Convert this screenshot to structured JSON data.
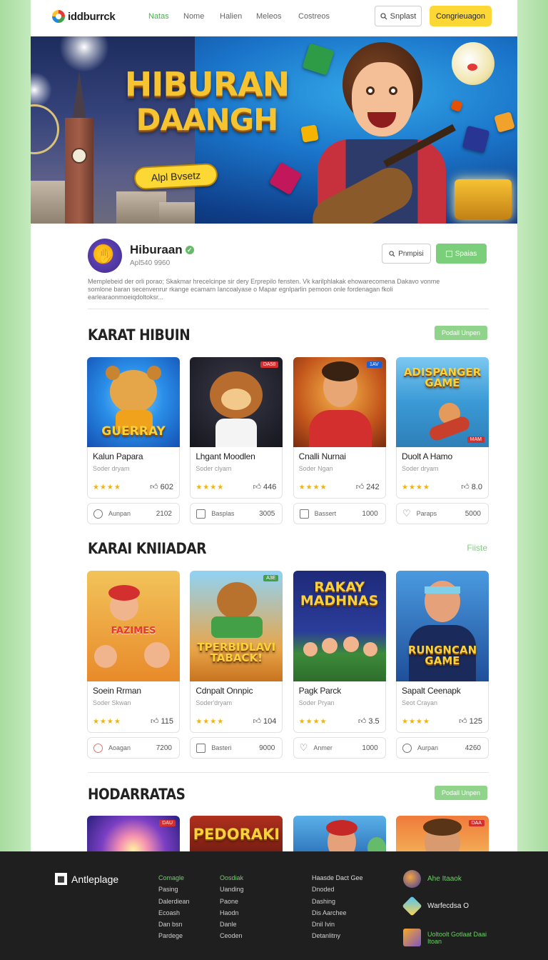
{
  "header": {
    "logo": "iddburrck",
    "nav": [
      "Natas",
      "Nome",
      "Halien",
      "Meleos",
      "Costreos"
    ],
    "search_label": "Snplast",
    "cta_label": "Congrieuagon"
  },
  "banner": {
    "title_line1": "HIBURAN",
    "title_line2": "DAANGH",
    "pill": "Alpl Bvsetz"
  },
  "profile": {
    "name": "Hiburaan",
    "stats": "Apl540  9960",
    "btn_primary": "Pnmpisi",
    "btn_secondary": "Spaias",
    "description": "Memplebeid der orli porao; Skakmar hrecelcinpe sir dery Erprepilo fensten. Vk karilphlakak ehowarecomena Dakavo vonme somlone baran secenvenrur rkange ecamarn Iancoalyase o Mapar egnlparlin pemoon onle fordenagan fkoli earlearaonmoeiqdoltoksr..."
  },
  "sections": [
    {
      "title": "KARAT HIBUIN",
      "action": "Podall Unpen",
      "cards": [
        {
          "title": "Kalun Papara",
          "sub": "Soder dryam",
          "count": "602",
          "foot_label": "Aunpan",
          "foot_value": "2102",
          "thumb_text": "GUERRAY",
          "tag": ""
        },
        {
          "title": "Lhgant Moodlen",
          "sub": "Soder clyam",
          "count": "446",
          "foot_label": "Basplas",
          "foot_value": "3005",
          "thumb_text": "",
          "tag": "DA58"
        },
        {
          "title": "Cnalli Nurnai",
          "sub": "Soder Ngan",
          "count": "242",
          "foot_label": "Bassert",
          "foot_value": "1000",
          "thumb_text": "",
          "tag": "1AV"
        },
        {
          "title": "Duolt A Hamo",
          "sub": "Soder dryam",
          "count": "8.0",
          "foot_label": "Paraps",
          "foot_value": "5000",
          "thumb_text": "ADISPANGER GAME",
          "tag": "MAM"
        }
      ]
    },
    {
      "title": "KARAI KNIIADAR",
      "action": "Fiiste",
      "cards": [
        {
          "title": "Soein Rrman",
          "sub": "Soder Skwan",
          "count": "115",
          "foot_label": "Aoagan",
          "foot_value": "7200",
          "thumb_text": "FAZIMES",
          "tag": ""
        },
        {
          "title": "Cdnpalt Onnpic",
          "sub": "Soder'dryam",
          "count": "104",
          "foot_label": "Basteri",
          "foot_value": "9000",
          "thumb_text": "TPERBIDLAVI TABACK!",
          "tag": "A3E"
        },
        {
          "title": "Pagk Parck",
          "sub": "Soder Pryan",
          "count": "3.5",
          "foot_label": "Anmer",
          "foot_value": "1000",
          "thumb_text": "RAKAY MADHNAS",
          "tag": ""
        },
        {
          "title": "Sapalt Ceenapk",
          "sub": "Seot Crayan",
          "count": "125",
          "foot_label": "Aurpan",
          "foot_value": "4260",
          "thumb_text": "RUNGNCAN GAME",
          "tag": ""
        }
      ]
    },
    {
      "title": "HODARRATAS",
      "action": "Podall Unpen",
      "cards": [
        {
          "thumb_text": "",
          "tag": "DAU"
        },
        {
          "thumb_text": "PEDORAKI",
          "tag": ""
        },
        {
          "thumb_text": "",
          "tag": ""
        },
        {
          "thumb_text": "",
          "tag": "DAA"
        }
      ]
    }
  ],
  "footer": {
    "logo": "Antleplage",
    "col1": [
      "Comagle",
      "Pasing",
      "Dalerdiean",
      "Ecoash",
      "Dan bsn",
      "Pardege"
    ],
    "col2": [
      "Oosdiak",
      "Uanding",
      "Paone",
      "Haodn",
      "Danle",
      "Ceoden"
    ],
    "col3": [
      "Haasde Dact Gee",
      "Dnoded",
      "Dashing",
      "Dis Aarchee",
      "Dnil Ivin",
      "Detanlitny"
    ],
    "apps": [
      "Ahe Itaaok",
      "Warfecdsa O",
      "Uoltoolt Gotlaat Daai Itoan"
    ]
  }
}
